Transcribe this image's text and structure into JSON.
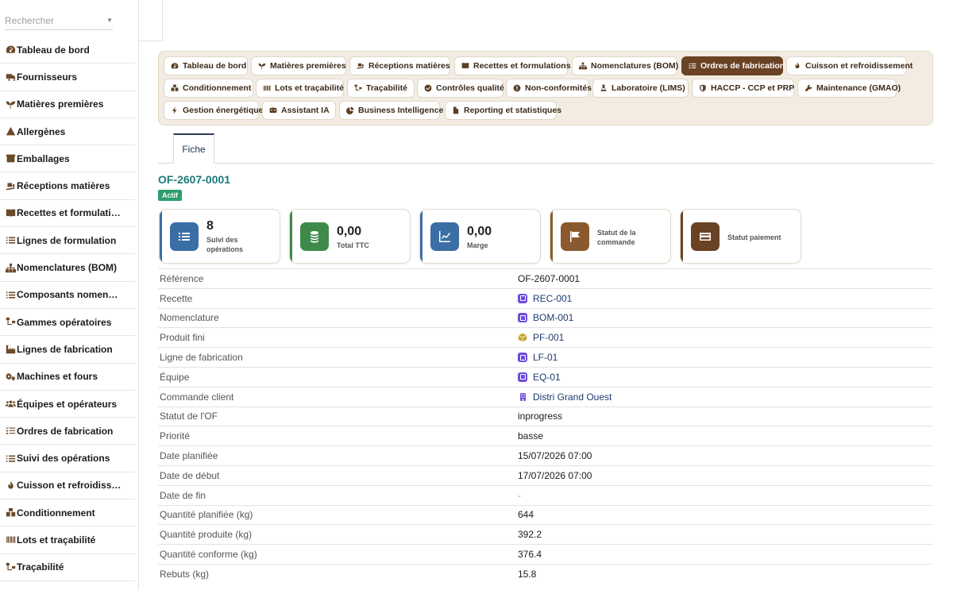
{
  "search": {
    "placeholder": "Rechercher"
  },
  "sidebar": {
    "items": [
      {
        "label": "Tableau de bord",
        "icon": "gauge-icon"
      },
      {
        "label": "Fournisseurs",
        "icon": "truck-icon"
      },
      {
        "label": "Matières premières",
        "icon": "seedling-icon"
      },
      {
        "label": "Allergènes",
        "icon": "warning-icon"
      },
      {
        "label": "Emballages",
        "icon": "box-icon"
      },
      {
        "label": "Réceptions matières",
        "icon": "truck-ramp-icon"
      },
      {
        "label": "Recettes et formulati…",
        "icon": "book-icon"
      },
      {
        "label": "Lignes de formulation",
        "icon": "list-icon"
      },
      {
        "label": "Nomenclatures (BOM)",
        "icon": "sitemap-icon"
      },
      {
        "label": "Composants nomen…",
        "icon": "list-icon"
      },
      {
        "label": "Gammes opératoires",
        "icon": "diagram-icon"
      },
      {
        "label": "Lignes de fabrication",
        "icon": "industry-icon"
      },
      {
        "label": "Machines et fours",
        "icon": "gears-icon"
      },
      {
        "label": "Équipes et opérateurs",
        "icon": "users-icon"
      },
      {
        "label": "Ordres de fabrication",
        "icon": "list-check-icon"
      },
      {
        "label": "Suivi des opérations",
        "icon": "list-icon"
      },
      {
        "label": "Cuisson et refroidiss…",
        "icon": "fire-icon"
      },
      {
        "label": "Conditionnement",
        "icon": "boxes-icon"
      },
      {
        "label": "Lots et traçabilité",
        "icon": "barcode-icon"
      },
      {
        "label": "Traçabilité",
        "icon": "diagram-icon"
      }
    ]
  },
  "nav": {
    "chips": [
      {
        "label": "Tableau de bord",
        "icon": "gauge-icon"
      },
      {
        "label": "Matières premières",
        "icon": "seedling-icon"
      },
      {
        "label": "Réceptions matières",
        "icon": "truck-ramp-icon"
      },
      {
        "label": "Recettes et formulations",
        "icon": "book-icon"
      },
      {
        "label": "Nomenclatures (BOM)",
        "icon": "sitemap-icon"
      },
      {
        "label": "Ordres de fabrication",
        "icon": "list-check-icon"
      },
      {
        "label": "Cuisson et refroidissement",
        "icon": "fire-icon"
      },
      {
        "label": "Conditionnement",
        "icon": "boxes-icon"
      },
      {
        "label": "Lots et traçabilité",
        "icon": "barcode-icon"
      },
      {
        "label": "Traçabilité",
        "icon": "diagram-icon"
      },
      {
        "label": "Contrôles qualité",
        "icon": "check-circle-icon"
      },
      {
        "label": "Non-conformités",
        "icon": "exclamation-icon"
      },
      {
        "label": "Laboratoire (LIMS)",
        "icon": "flask-icon"
      },
      {
        "label": "HACCP - CCP et PRP",
        "icon": "shield-icon"
      },
      {
        "label": "Maintenance (GMAO)",
        "icon": "wrench-icon"
      },
      {
        "label": "Gestion énergétique",
        "icon": "bolt-icon"
      },
      {
        "label": "Assistant IA",
        "icon": "robot-icon"
      },
      {
        "label": "Business Intelligence",
        "icon": "pie-icon"
      },
      {
        "label": "Reporting et statistiques",
        "icon": "file-icon"
      }
    ],
    "active_index": 5
  },
  "tabs": {
    "fiche": "Fiche"
  },
  "record": {
    "title": "OF-2607-0001",
    "status_badge": "Actif"
  },
  "cards": [
    {
      "value": "8",
      "label": "Suivi des opérations",
      "color": "#3a6ea5",
      "icon": "list-icon"
    },
    {
      "value": "0,00",
      "label": "Total TTC",
      "color": "#3f8a4a",
      "icon": "coins-icon"
    },
    {
      "value": "0,00",
      "label": "Marge",
      "color": "#3a6ea5",
      "icon": "chart-icon"
    },
    {
      "value": "",
      "label": "Statut de la commande",
      "color": "#8a5a2e",
      "icon": "flag-icon"
    },
    {
      "value": "",
      "label": "Statut paiement",
      "color": "#6a4224",
      "icon": "card-icon"
    }
  ],
  "details": [
    {
      "key": "Référence",
      "value": "OF-2607-0001"
    },
    {
      "key": "Recette",
      "value": "REC-001",
      "link": true,
      "icon": "purple"
    },
    {
      "key": "Nomenclature",
      "value": "BOM-001",
      "link": true,
      "icon": "purple"
    },
    {
      "key": "Produit fini",
      "value": "PF-001",
      "link": true,
      "icon": "cube"
    },
    {
      "key": "Ligne de fabrication",
      "value": "LF-01",
      "link": true,
      "icon": "purple"
    },
    {
      "key": "Équipe",
      "value": "EQ-01",
      "link": true,
      "icon": "purple"
    },
    {
      "key": "Commande client",
      "value": "Distri Grand Ouest",
      "link": true,
      "icon": "building"
    },
    {
      "key": "Statut de l'OF",
      "value": "inprogress"
    },
    {
      "key": "Priorité",
      "value": "basse"
    },
    {
      "key": "Date planifiée",
      "value": "15/07/2026 07:00"
    },
    {
      "key": "Date de début",
      "value": "17/07/2026 07:00"
    },
    {
      "key": "Date de fin",
      "value": "-",
      "dim": true
    },
    {
      "key": "Quantité planifiée (kg)",
      "value": "644"
    },
    {
      "key": "Quantité produite (kg)",
      "value": "392.2"
    },
    {
      "key": "Quantité conforme (kg)",
      "value": "376.4"
    },
    {
      "key": "Rebuts (kg)",
      "value": "15.8"
    }
  ]
}
